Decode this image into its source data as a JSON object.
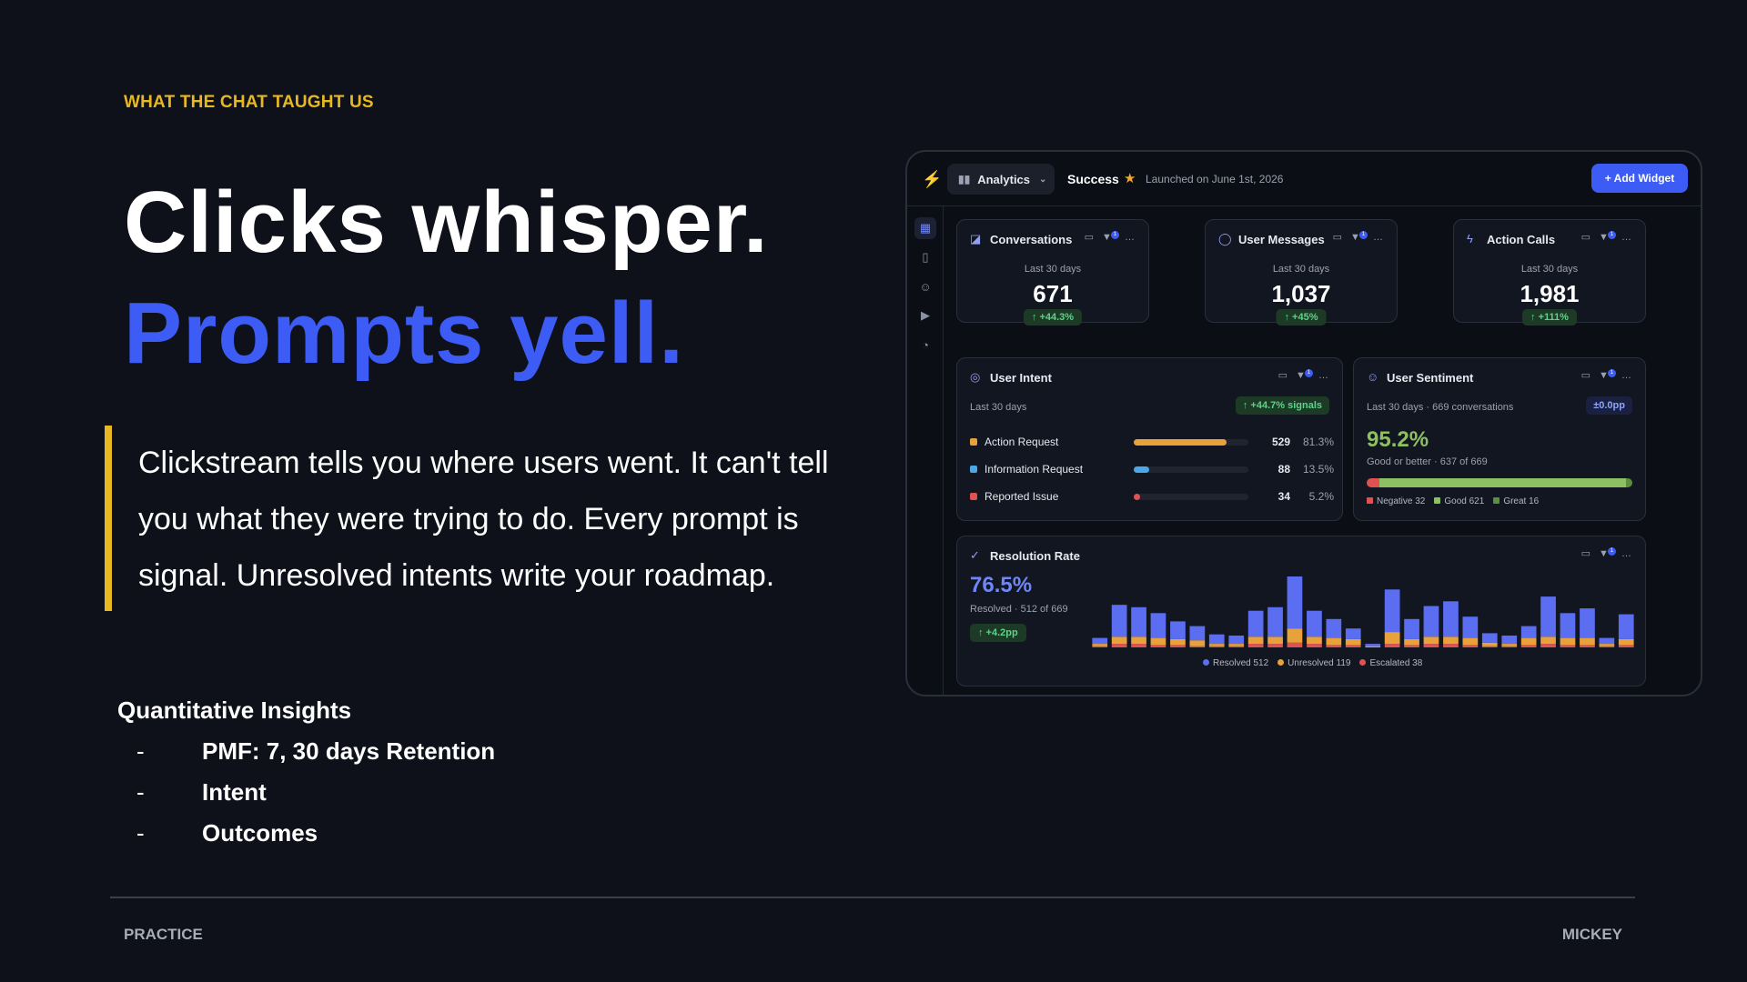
{
  "slide": {
    "kicker": "WHAT THE CHAT TAUGHT US",
    "headline_line1": "Clicks whisper.",
    "headline_line2": "Prompts yell.",
    "quote": "Clickstream tells you where users went. It can't tell you what they were trying to do. Every prompt is signal. Unresolved intents write your roadmap.",
    "insights_title": "Quantitative Insights",
    "insights": [
      "PMF: 7, 30 days Retention",
      "Intent",
      "Outcomes"
    ],
    "footer_left": "PRACTICE",
    "footer_right": "MICKEY"
  },
  "dashboard": {
    "nav_label": "Analytics",
    "status": "Success",
    "launched": "Launched on June 1st, 2026",
    "add_widget": "+ Add Widget",
    "filter_badge": "1",
    "stats": [
      {
        "title": "Conversations",
        "period": "Last 30 days",
        "value": "671",
        "delta": "↑ +44.3%"
      },
      {
        "title": "User Messages",
        "period": "Last 30 days",
        "value": "1,037",
        "delta": "↑ +45%"
      },
      {
        "title": "Action Calls",
        "period": "Last 30 days",
        "value": "1,981",
        "delta": "↑ +111%"
      }
    ],
    "intent": {
      "title": "User Intent",
      "period": "Last 30 days",
      "delta": "↑ +44.7% signals",
      "rows": [
        {
          "label": "Action Request",
          "count": "529",
          "pct": "81.3%",
          "fraction": 0.813,
          "color": "#e9a23b"
        },
        {
          "label": "Information Request",
          "count": "88",
          "pct": "13.5%",
          "fraction": 0.135,
          "color": "#4aa8e8"
        },
        {
          "label": "Reported Issue",
          "count": "34",
          "pct": "5.2%",
          "fraction": 0.052,
          "color": "#e05252"
        }
      ]
    },
    "sentiment": {
      "title": "User Sentiment",
      "period": "Last 30 days · 669 conversations",
      "delta": "±0.0pp",
      "value": "95.2%",
      "caption": "Good or better · 637 of 669",
      "segments": [
        {
          "label": "Negative 32",
          "fraction": 0.048,
          "color": "#e05252"
        },
        {
          "label": "Good 621",
          "fraction": 0.928,
          "color": "#8cc063"
        },
        {
          "label": "Great 16",
          "fraction": 0.024,
          "color": "#5a8f3e"
        }
      ]
    },
    "resolution": {
      "title": "Resolution Rate",
      "value": "76.5%",
      "caption": "Resolved · 512 of 669",
      "delta": "↑ +4.2pp",
      "legend": [
        {
          "label": "Resolved 512",
          "color": "#5b6ef2"
        },
        {
          "label": "Unresolved 119",
          "color": "#e9a23b"
        },
        {
          "label": "Escalated 38",
          "color": "#e05252"
        }
      ],
      "chart_data": {
        "type": "bar",
        "stacked": true,
        "series": [
          {
            "name": "Resolved",
            "values": [
              5,
              27,
              25,
              21,
              15,
              12,
              8,
              7,
              22,
              25,
              44,
              22,
              16,
              9,
              2,
              36,
              17,
              26,
              30,
              18,
              8,
              7,
              10,
              34,
              21,
              25,
              5,
              21
            ]
          },
          {
            "name": "Unresolved",
            "values": [
              2,
              6,
              6,
              6,
              5,
              5,
              2,
              2,
              6,
              6,
              12,
              6,
              6,
              5,
              1,
              10,
              5,
              6,
              6,
              6,
              3,
              2,
              6,
              6,
              6,
              6,
              2,
              5
            ]
          },
          {
            "name": "Escalated",
            "values": [
              1,
              3,
              3,
              2,
              2,
              1,
              1,
              1,
              3,
              3,
              4,
              3,
              2,
              2,
              0,
              3,
              2,
              3,
              3,
              2,
              1,
              1,
              2,
              3,
              2,
              2,
              1,
              2
            ]
          }
        ]
      }
    }
  }
}
